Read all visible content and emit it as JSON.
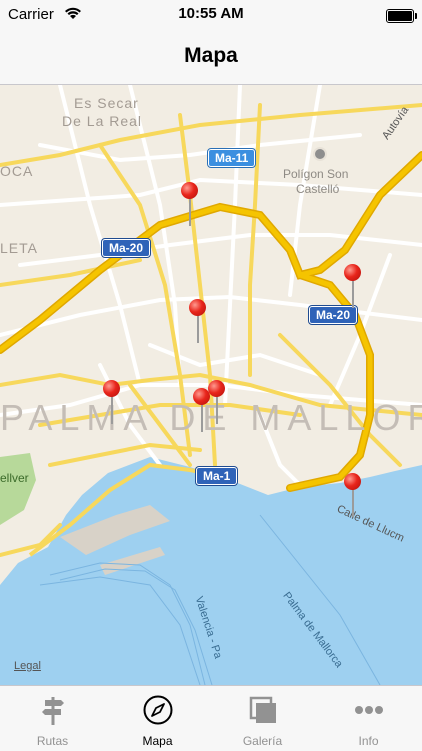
{
  "status": {
    "carrier": "Carrier",
    "time": "10:55 AM"
  },
  "nav": {
    "title": "Mapa"
  },
  "map": {
    "labels": {
      "es_secar": "Es Secar",
      "de_la_real": "De La Real",
      "oca": "OCA",
      "leta": "LETA",
      "poligon": "Polígon Son",
      "castello": "Castelló",
      "palma": "PALMA DE MALLORCA",
      "bellver": "ellver",
      "autovia": "Autovía",
      "calle_llucmajor": "Calle de Llucm",
      "valencia": "Valencia - Pa",
      "palma_de_mallorca_route": "Palma de Mallorca"
    },
    "shields": {
      "ma11": "Ma-11",
      "ma20_left": "Ma-20",
      "ma20_right": "Ma-20",
      "ma1": "Ma-1"
    },
    "legal": "Legal",
    "pin_count": 8
  },
  "tabs": [
    {
      "label": "Rutas",
      "icon": "signpost-icon",
      "active": false
    },
    {
      "label": "Mapa",
      "icon": "compass-icon",
      "active": true
    },
    {
      "label": "Galería",
      "icon": "gallery-icon",
      "active": false
    },
    {
      "label": "Info",
      "icon": "more-dots-icon",
      "active": false
    }
  ],
  "colors": {
    "tab_inactive": "#929292",
    "tab_active": "#000000",
    "pin": "#e8251b",
    "highway": "#f2c200",
    "water": "#9ed0f0",
    "land": "#f2ede3"
  }
}
